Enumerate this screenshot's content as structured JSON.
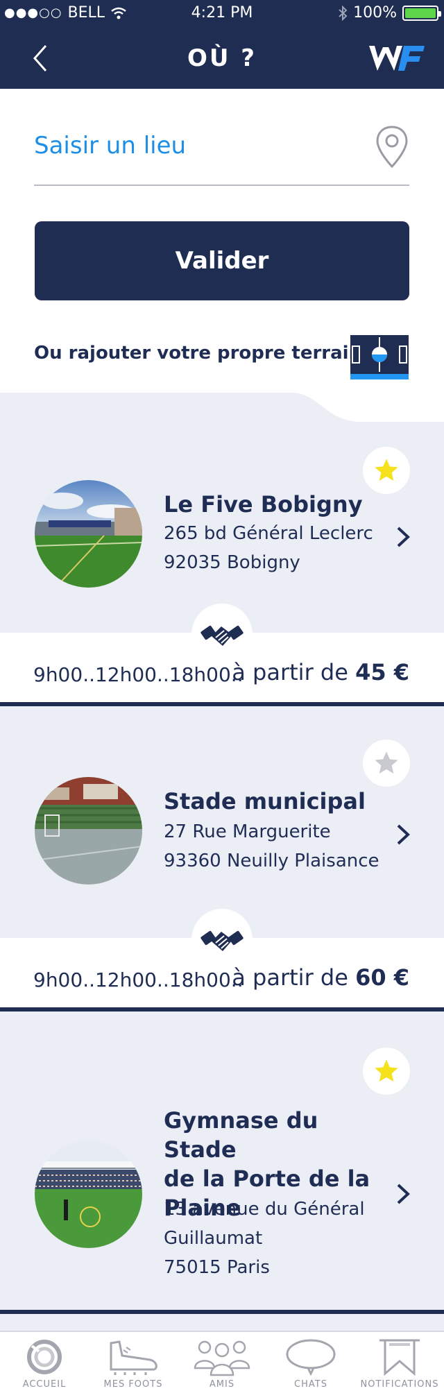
{
  "status_bar": {
    "signal": "●●●○○",
    "carrier": "BELL",
    "time": "4:21 PM",
    "battery": "100%"
  },
  "nav": {
    "title": "OÙ ?",
    "logo": "WF"
  },
  "search": {
    "placeholder": "Saisir un lieu",
    "value": ""
  },
  "validate_label": "Valider",
  "add_field_text": "Ou rajouter votre propre terrain",
  "colors": {
    "navy": "#1f2d52",
    "accent": "#2196f3",
    "star_active": "#f5e21c",
    "star_inactive": "#c8cacf"
  },
  "venues": [
    {
      "name": "Le Five Bobigny",
      "address_line1": "265 bd Général Leclerc",
      "address_line2": "92035 Bobigny",
      "favorite": true,
      "hours": "9h00..12h00..18h00..",
      "price_prefix": "à partir de",
      "price": "45 €"
    },
    {
      "name": "Stade municipal",
      "address_line1": "27 Rue Marguerite",
      "address_line2": "93360 Neuilly Plaisance",
      "favorite": false,
      "hours": "9h00..12h00..18h00..",
      "price_prefix": "à partir de",
      "price": "60 €"
    },
    {
      "name_line1": "Gymnase du Stade",
      "name_line2": "de la Porte de la",
      "name_line3": "Plaine",
      "address_line1": "13 avenue du Général",
      "address_line2": "Guillaumat",
      "address_line3": "75015 Paris",
      "favorite": true
    }
  ],
  "tabs": [
    {
      "label": "ACCUEIL",
      "icon": "home-ring-icon"
    },
    {
      "label": "MES FOOTS",
      "icon": "football-boot-icon"
    },
    {
      "label": "AMIS",
      "icon": "team-icon"
    },
    {
      "label": "CHATS",
      "icon": "chat-bubble-icon"
    },
    {
      "label": "NOTIFICATIONS",
      "icon": "notification-flag-icon"
    }
  ]
}
